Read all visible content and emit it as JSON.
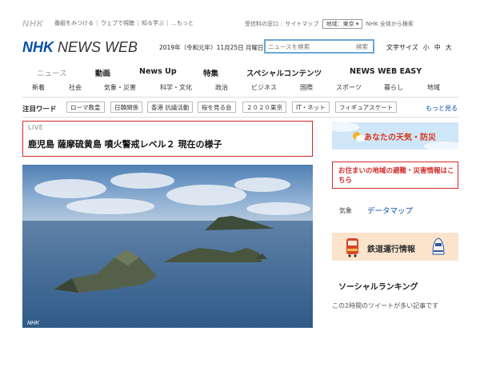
{
  "utility_bar": {
    "brand": "NHK",
    "links": [
      "番組をみつける",
      "ウェブで視聴",
      "知る学ぶ",
      "…もっと"
    ],
    "right": {
      "reception": "受信料の窓口",
      "sitemap": "サイトマップ",
      "region_label": "地域：東京",
      "all_search": "NHK 全体から検索"
    }
  },
  "header": {
    "logo_nhk": "NHK",
    "logo_rest": "NEWS WEB",
    "date": "2019年（令和元年）11月25日 月曜日",
    "search_placeholder": "ニュースを検索",
    "search_button": "検索",
    "font_size_label": "文字サイズ",
    "font_sizes": [
      "小",
      "中",
      "大"
    ]
  },
  "nav": {
    "items": [
      "ニュース",
      "動画",
      "News Up",
      "特集",
      "スペシャルコンテンツ",
      "NEWS WEB EASY"
    ]
  },
  "subnav": {
    "items": [
      "新着",
      "社会",
      "気象・災害",
      "科学・文化",
      "政治",
      "ビジネス",
      "国際",
      "スポーツ",
      "暮らし",
      "地域"
    ]
  },
  "keywords": {
    "label": "注目ワード",
    "items": [
      "ローマ教皇",
      "日韓関係",
      "香港 抗議活動",
      "桜を見る会",
      "２０２０東京",
      "IT・ネット",
      "フィギュアスケート"
    ],
    "more": "もっと見る"
  },
  "main": {
    "live_label": "LIVE",
    "headline": "鹿児島 薩摩硫黄島 噴火警戒レベル２ 現在の様子",
    "photo_watermark": "NHK"
  },
  "sidebar": {
    "weather": "あなたの天気・防災",
    "evacuation": "お住まいの地域の避難・災害情報はこちら",
    "datamap_label": "気象",
    "datamap_link": "データマップ",
    "train": "鉄道運行情報",
    "social_title": "ソーシャルランキング",
    "social_desc": "この2時間のツイートが多い記事です"
  },
  "colors": {
    "brand_blue": "#0a4fa8",
    "alert_red": "#d22b2b",
    "weather_text": "#d63a1e"
  }
}
